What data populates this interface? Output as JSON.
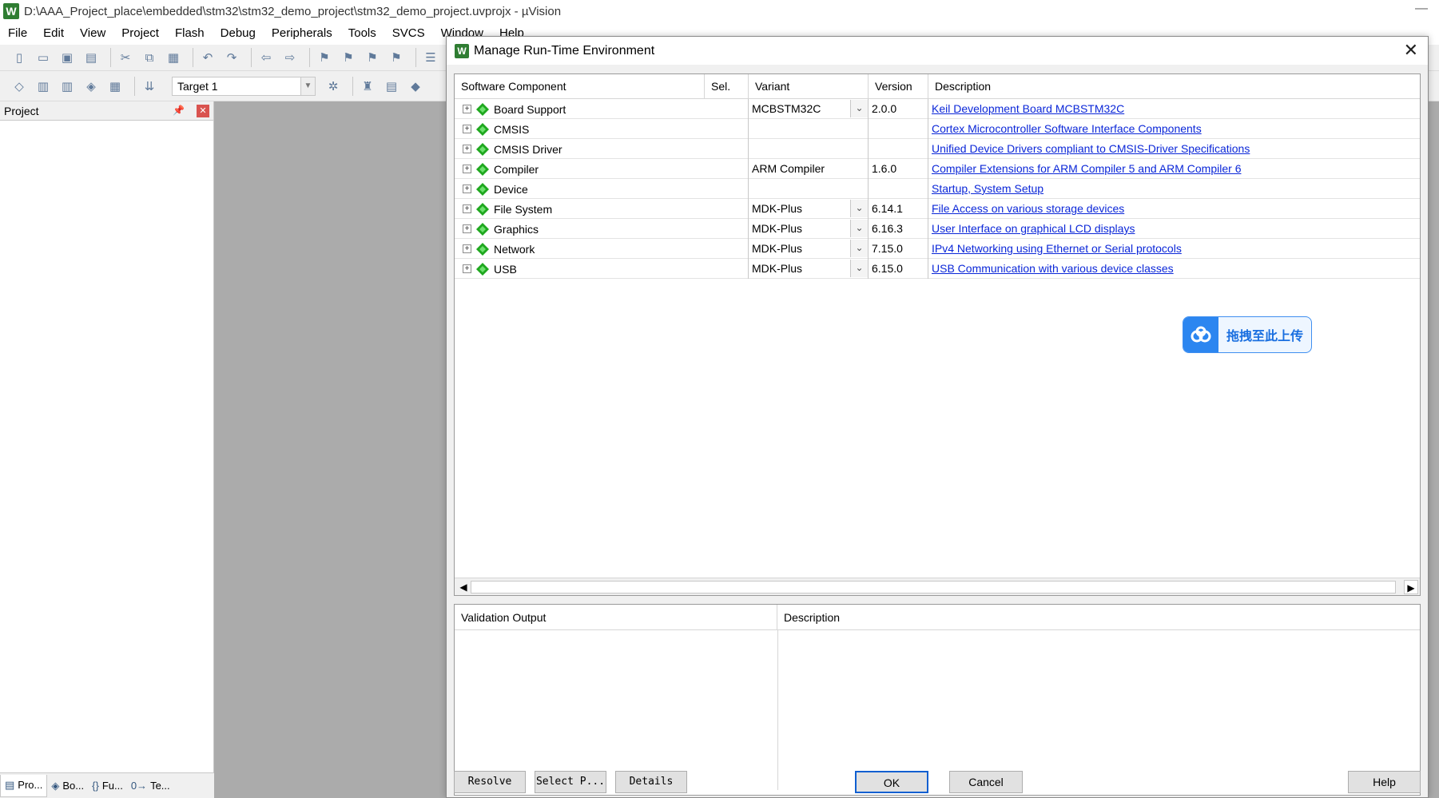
{
  "app": {
    "title": "D:\\AAA_Project_place\\embedded\\stm32\\stm32_demo_project\\stm32_demo_project.uvprojx - µVision",
    "icon_letter": "W",
    "minimize_glyph": "—"
  },
  "menu": [
    "File",
    "Edit",
    "View",
    "Project",
    "Flash",
    "Debug",
    "Peripherals",
    "Tools",
    "SVCS",
    "Window",
    "Help"
  ],
  "toolbar": {
    "target": "Target 1"
  },
  "project_panel": {
    "title": "Project",
    "tabs": [
      {
        "label": "Pro...",
        "icon": "project-book-icon",
        "glyph": "▤"
      },
      {
        "label": "Bo...",
        "icon": "books-icon",
        "glyph": "◈"
      },
      {
        "label": "Fu...",
        "icon": "functions-icon",
        "glyph": "{}"
      },
      {
        "label": "Te...",
        "icon": "templates-icon",
        "glyph": "0→"
      }
    ]
  },
  "dialog": {
    "title": "Manage Run-Time Environment",
    "icon_letter": "W",
    "columns": [
      "Software Component",
      "Sel.",
      "Variant",
      "Version",
      "Description"
    ],
    "components": [
      {
        "name": "Board Support",
        "variant": "MCBSTM32C",
        "has_dropdown": true,
        "version": "2.0.0",
        "description": "Keil Development Board MCBSTM32C"
      },
      {
        "name": "CMSIS",
        "variant": "",
        "has_dropdown": false,
        "version": "",
        "description": "Cortex Microcontroller Software Interface Components"
      },
      {
        "name": "CMSIS Driver",
        "variant": "",
        "has_dropdown": false,
        "version": "",
        "description": "Unified Device Drivers compliant to CMSIS-Driver Specifications"
      },
      {
        "name": "Compiler",
        "variant": "ARM Compiler",
        "has_dropdown": false,
        "version": "1.6.0",
        "description": "Compiler Extensions for ARM Compiler 5 and ARM Compiler 6"
      },
      {
        "name": "Device",
        "variant": "",
        "has_dropdown": false,
        "version": "",
        "description": "Startup, System Setup"
      },
      {
        "name": "File System",
        "variant": "MDK-Plus",
        "has_dropdown": true,
        "version": "6.14.1",
        "description": "File Access on various storage devices"
      },
      {
        "name": "Graphics",
        "variant": "MDK-Plus",
        "has_dropdown": true,
        "version": "6.16.3",
        "description": "User Interface on graphical LCD displays"
      },
      {
        "name": "Network",
        "variant": "MDK-Plus",
        "has_dropdown": true,
        "version": "7.15.0",
        "description": "IPv4 Networking using Ethernet or Serial protocols"
      },
      {
        "name": "USB",
        "variant": "MDK-Plus",
        "has_dropdown": true,
        "version": "6.15.0",
        "description": "USB Communication with various device classes"
      }
    ],
    "upload_badge": "拖拽至此上传",
    "validation": {
      "col1": "Validation Output",
      "col2": "Description"
    },
    "buttons": {
      "resolve": "Resolve",
      "select_packs": "Select P...",
      "details": "Details",
      "ok": "OK",
      "cancel": "Cancel",
      "help": "Help"
    }
  },
  "colors": {
    "link": "#0b27d8",
    "component_icon": "#1fa81f",
    "upload_accent": "#2c86f0"
  }
}
